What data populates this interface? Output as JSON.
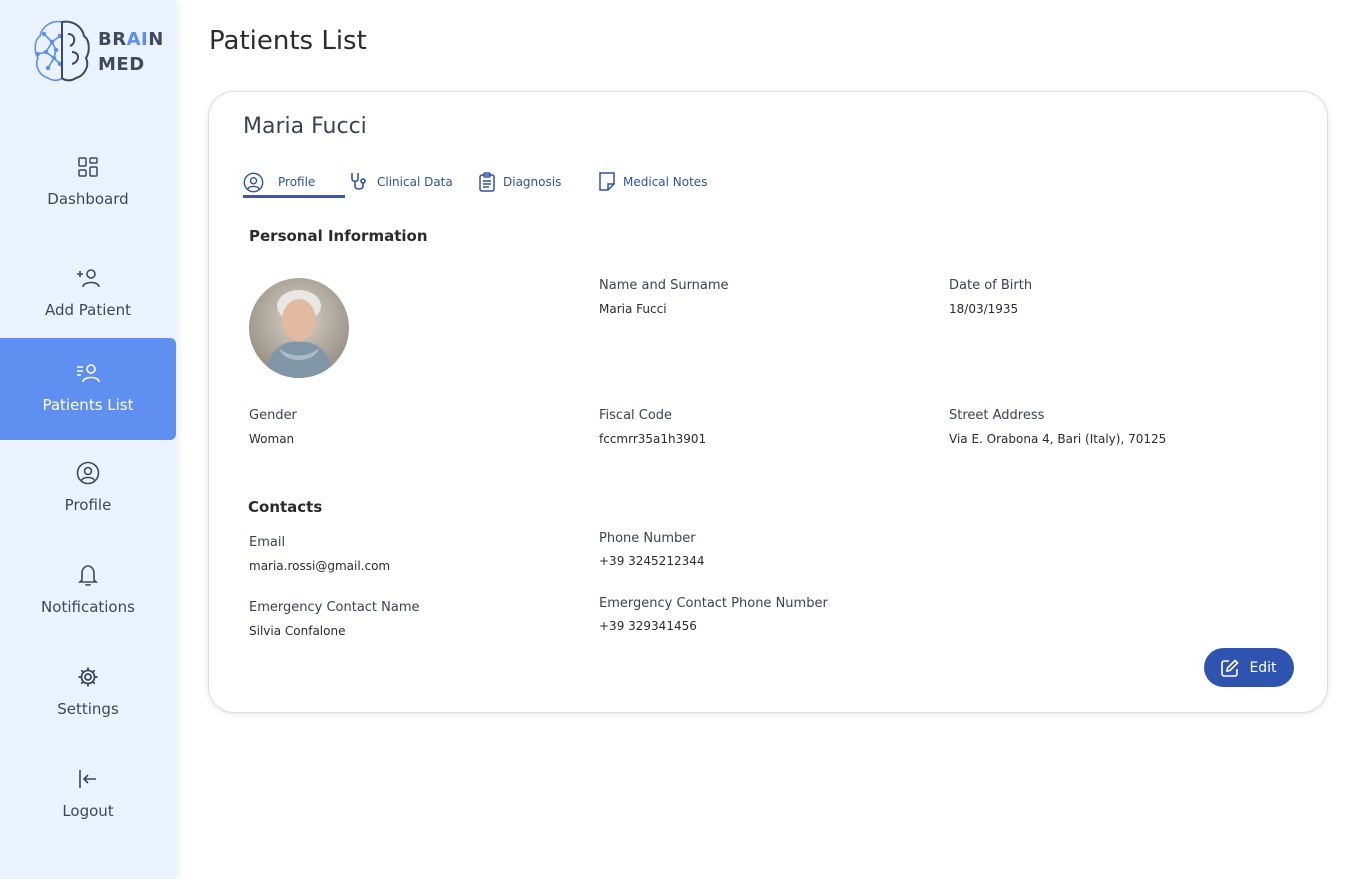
{
  "brand": {
    "line1_a": "BR",
    "line1_b": "AI",
    "line1_c": "N",
    "line2": "MED"
  },
  "colors": {
    "accent": "#5f90f1",
    "primary": "#2f54b0",
    "sidebar_bg": "#eaf3fd"
  },
  "sidebar": {
    "items": [
      {
        "label": "Dashboard",
        "icon": "dashboard-icon",
        "active": false
      },
      {
        "label": "Add Patient",
        "icon": "add-user-icon",
        "active": false
      },
      {
        "label": "Patients List",
        "icon": "patients-list-icon",
        "active": true
      },
      {
        "label": "Profile",
        "icon": "user-circle-icon",
        "active": false
      },
      {
        "label": "Notifications",
        "icon": "bell-icon",
        "active": false
      },
      {
        "label": "Settings",
        "icon": "gear-icon",
        "active": false
      },
      {
        "label": "Logout",
        "icon": "logout-icon",
        "active": false
      }
    ]
  },
  "page": {
    "title": "Patients List"
  },
  "patient": {
    "name": "Maria Fucci"
  },
  "tabs": [
    {
      "label": "Profile",
      "icon": "user-circle-icon",
      "active": true
    },
    {
      "label": "Clinical Data",
      "icon": "stethoscope-icon",
      "active": false
    },
    {
      "label": "Diagnosis",
      "icon": "clipboard-icon",
      "active": false
    },
    {
      "label": "Medical Notes",
      "icon": "note-icon",
      "active": false
    }
  ],
  "personal": {
    "title": "Personal Information",
    "name_label": "Name and Surname",
    "name_value": "Maria Fucci",
    "dob_label": "Date of Birth",
    "dob_value": "18/03/1935",
    "gender_label": "Gender",
    "gender_value": "Woman",
    "fiscal_label": "Fiscal Code",
    "fiscal_value": "fccmrr35a1h3901",
    "address_label": "Street Address",
    "address_value": "Via E. Orabona 4, Bari (Italy), 70125"
  },
  "contacts": {
    "title": "Contacts",
    "email_label": "Email",
    "email_value": "maria.rossi@gmail.com",
    "phone_label": "Phone Number",
    "phone_value": "+39 3245212344",
    "emergency_name_label": "Emergency Contact Name",
    "emergency_name_value": "Silvia Confalone",
    "emergency_phone_label": "Emergency Contact Phone Number",
    "emergency_phone_value": "+39 329341456"
  },
  "actions": {
    "edit_label": "Edit"
  }
}
